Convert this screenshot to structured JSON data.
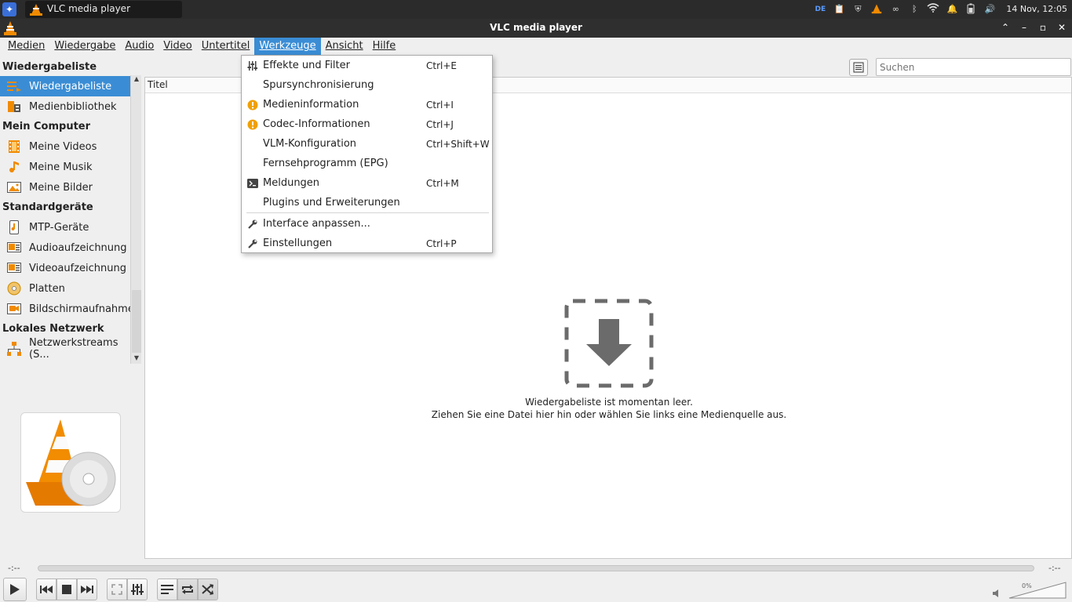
{
  "panel": {
    "task_title": "VLC media player",
    "keyboard_layout": "DE",
    "clock": "14 Nov, 12:05"
  },
  "window": {
    "title": "VLC media player"
  },
  "menubar": {
    "items": [
      "Medien",
      "Wiedergabe",
      "Audio",
      "Video",
      "Untertitel",
      "Werkzeuge",
      "Ansicht",
      "Hilfe"
    ],
    "active": "Werkzeuge"
  },
  "sidebar": {
    "sections": {
      "playlist": "Wiedergabeliste",
      "computer": "Mein Computer",
      "devices": "Standardgeräte",
      "network": "Lokales Netzwerk"
    },
    "items": {
      "playlist": "Wiedergabeliste",
      "library": "Medienbibliothek",
      "videos": "Meine Videos",
      "music": "Meine Musik",
      "pictures": "Meine Bilder",
      "mtp": "MTP-Geräte",
      "audio_capture": "Audioaufzeichnung",
      "video_capture": "Videoaufzeichnung",
      "discs": "Platten",
      "screen_capture": "Bildschirmaufnahme",
      "network_streams": "Netzwerkstreams (S..."
    }
  },
  "search": {
    "placeholder": "Suchen"
  },
  "playlist": {
    "column_title": "Titel",
    "empty_line1": "Wiedergabeliste ist momentan leer.",
    "empty_line2": "Ziehen Sie eine Datei hier hin oder wählen Sie links eine Medienquelle aus."
  },
  "tools_menu": {
    "items": [
      {
        "label": "Effekte und Filter",
        "shortcut": "Ctrl+E",
        "icon": "equalizer-icon"
      },
      {
        "label": "Spursynchronisierung",
        "shortcut": "",
        "icon": ""
      },
      {
        "label": "Medieninformation",
        "shortcut": "Ctrl+I",
        "icon": "info-icon"
      },
      {
        "label": "Codec-Informationen",
        "shortcut": "Ctrl+J",
        "icon": "info-icon"
      },
      {
        "label": "VLM-Konfiguration",
        "shortcut": "Ctrl+Shift+W",
        "icon": ""
      },
      {
        "label": "Fernsehprogramm (EPG)",
        "shortcut": "",
        "icon": ""
      },
      {
        "label": "Meldungen",
        "shortcut": "Ctrl+M",
        "icon": "terminal-icon"
      },
      {
        "label": "Plugins und Erweiterungen",
        "shortcut": "",
        "icon": ""
      },
      {
        "label": "Interface anpassen...",
        "shortcut": "",
        "icon": "wrench-icon"
      },
      {
        "label": "Einstellungen",
        "shortcut": "Ctrl+P",
        "icon": "wrench-icon"
      }
    ]
  },
  "playback": {
    "elapsed": "-:--",
    "remaining": "-:--",
    "volume": "0%"
  },
  "colors": {
    "accent": "#3a8dd5",
    "vlc_orange": "#f08a00",
    "panel": "#2b2b2b"
  }
}
